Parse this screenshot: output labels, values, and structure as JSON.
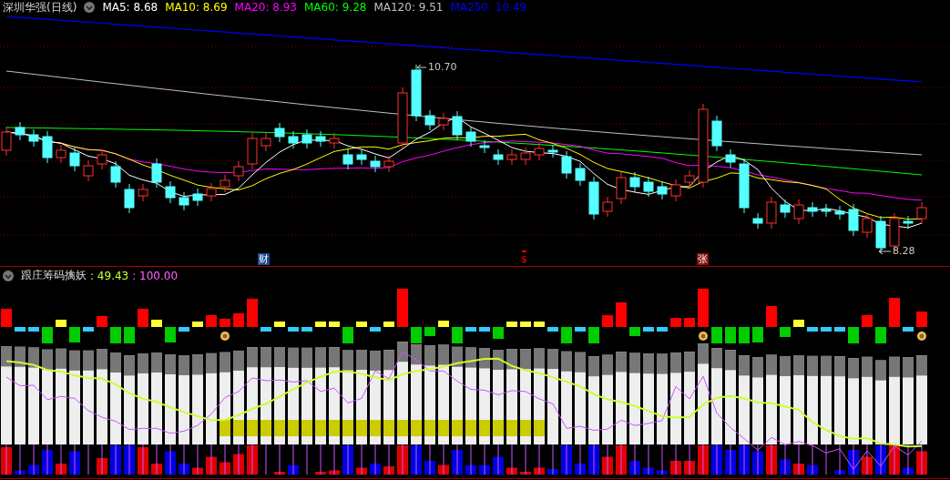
{
  "chart": {
    "title": "深圳华强(日线)",
    "moving_averages": [
      {
        "label": "MA5: 8.68",
        "color": "#ffffff"
      },
      {
        "label": "MA10: 8.69",
        "color": "#ffff00"
      },
      {
        "label": "MA20: 8.93",
        "color": "#ff00ff"
      },
      {
        "label": "MA60: 9.28",
        "color": "#00ff00"
      },
      {
        "label": "MA120: 9.51",
        "color": "#c0c0c0"
      },
      {
        "label": "MA250: 10.49",
        "color": "#0000ff"
      }
    ],
    "price_labels": [
      {
        "kind": "high",
        "text": "10.70"
      },
      {
        "kind": "low",
        "text": "8.28"
      }
    ],
    "event_markers": [
      {
        "kind": "badge",
        "text": "财",
        "color": "#1c4a8a"
      },
      {
        "kind": "plain",
        "text": "$",
        "color": "#ff0000"
      },
      {
        "kind": "badge",
        "text": "张",
        "color": "#8a1010"
      }
    ]
  },
  "indicator": {
    "name": "跟庄筹码擒妖",
    "values": [
      {
        "text": ": 49.43",
        "color": "#ccff33"
      },
      {
        "text": ": 100.00",
        "color": "#ff66ff"
      }
    ]
  }
}
